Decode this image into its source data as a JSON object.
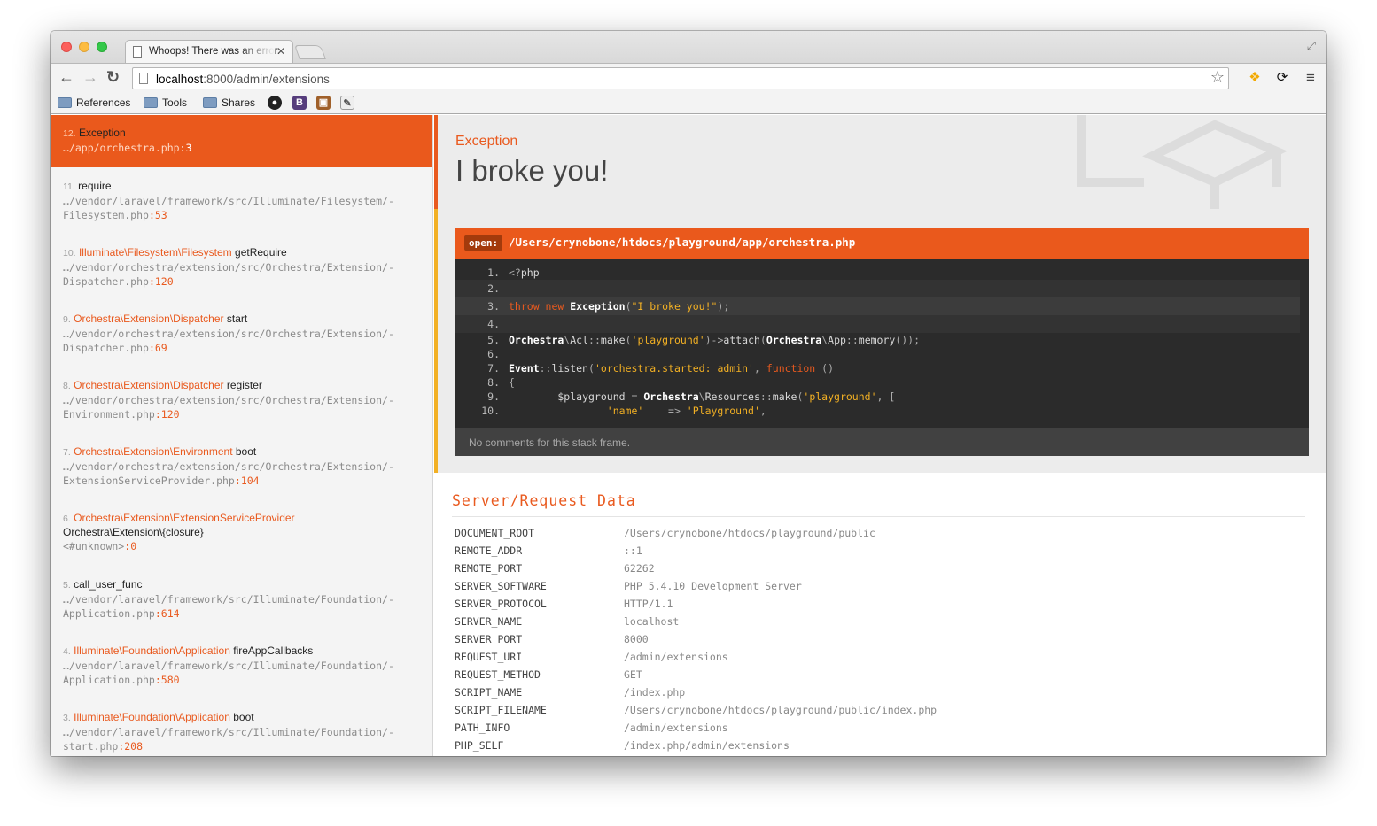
{
  "browser": {
    "tab_title": "Whoops! There was an error.",
    "url_host": "localhost",
    "url_path": ":8000/admin/extensions",
    "bookmarks": [
      {
        "label": "References"
      },
      {
        "label": "Tools"
      },
      {
        "label": "Shares"
      }
    ],
    "bookmark_icon_b": "B"
  },
  "frames": [
    {
      "index": "12.",
      "class": "",
      "function": "Exception",
      "file": "…/app/orchestra.php",
      "line": "3"
    },
    {
      "index": "11.",
      "class": "",
      "function": "require",
      "file": "…/vendor/laravel/framework/src/Illuminate/Filesystem/-",
      "file2": "Filesystem.php",
      "line": "53"
    },
    {
      "index": "10.",
      "class": "Illuminate\\Filesystem\\Filesystem",
      "function": "getRequire",
      "file": "…/vendor/orchestra/extension/src/Orchestra/Extension/-",
      "file2": "Dispatcher.php",
      "line": "120"
    },
    {
      "index": "9.",
      "class": "Orchestra\\Extension\\Dispatcher",
      "function": "start",
      "file": "…/vendor/orchestra/extension/src/Orchestra/Extension/-",
      "file2": "Dispatcher.php",
      "line": "69"
    },
    {
      "index": "8.",
      "class": "Orchestra\\Extension\\Dispatcher",
      "function": "register",
      "file": "…/vendor/orchestra/extension/src/Orchestra/Extension/-",
      "file2": "Environment.php",
      "line": "120"
    },
    {
      "index": "7.",
      "class": "Orchestra\\Extension\\Environment",
      "function": "boot",
      "file": "…/vendor/orchestra/extension/src/Orchestra/Extension/-",
      "file2": "ExtensionServiceProvider.php",
      "line": "104"
    },
    {
      "index": "6.",
      "class": "Orchestra\\Extension\\ExtensionServiceProvider",
      "function": "Orchestra\\Extension\\{closure}",
      "file": "<#unknown>",
      "line": "0"
    },
    {
      "index": "5.",
      "class": "",
      "function": "call_user_func",
      "file": "…/vendor/laravel/framework/src/Illuminate/Foundation/-",
      "file2": "Application.php",
      "line": "614"
    },
    {
      "index": "4.",
      "class": "Illuminate\\Foundation\\Application",
      "function": "fireAppCallbacks",
      "file": "…/vendor/laravel/framework/src/Illuminate/Foundation/-",
      "file2": "Application.php",
      "line": "580"
    },
    {
      "index": "3.",
      "class": "Illuminate\\Foundation\\Application",
      "function": "boot",
      "file": "…/vendor/laravel/framework/src/Illuminate/Foundation/-",
      "file2": "start.php",
      "line": "208"
    }
  ],
  "exception": {
    "type": "Exception",
    "message": "I broke you!"
  },
  "code": {
    "open_label": "open:",
    "path": "/Users/crynobone/htdocs/playground/app/orchestra.php",
    "line_numbers": [
      "1.",
      "2.",
      "3.",
      "4.",
      "5.",
      "6.",
      "7.",
      "8.",
      "9.",
      "10."
    ],
    "comments": "No comments for this stack frame."
  },
  "server": {
    "title": "Server/Request Data",
    "rows": [
      {
        "key": "DOCUMENT_ROOT",
        "value": "/Users/crynobone/htdocs/playground/public"
      },
      {
        "key": "REMOTE_ADDR",
        "value": "::1"
      },
      {
        "key": "REMOTE_PORT",
        "value": "62262"
      },
      {
        "key": "SERVER_SOFTWARE",
        "value": "PHP 5.4.10 Development Server"
      },
      {
        "key": "SERVER_PROTOCOL",
        "value": "HTTP/1.1"
      },
      {
        "key": "SERVER_NAME",
        "value": "localhost"
      },
      {
        "key": "SERVER_PORT",
        "value": "8000"
      },
      {
        "key": "REQUEST_URI",
        "value": "/admin/extensions"
      },
      {
        "key": "REQUEST_METHOD",
        "value": "GET"
      },
      {
        "key": "SCRIPT_NAME",
        "value": "/index.php"
      },
      {
        "key": "SCRIPT_FILENAME",
        "value": "/Users/crynobone/htdocs/playground/public/index.php"
      },
      {
        "key": "PATH_INFO",
        "value": "/admin/extensions"
      },
      {
        "key": "PHP_SELF",
        "value": "/index.php/admin/extensions"
      }
    ]
  },
  "colors": {
    "accent": "#ea591c",
    "highlight": "#f2b024",
    "code_bg": "#2b2b2b"
  }
}
